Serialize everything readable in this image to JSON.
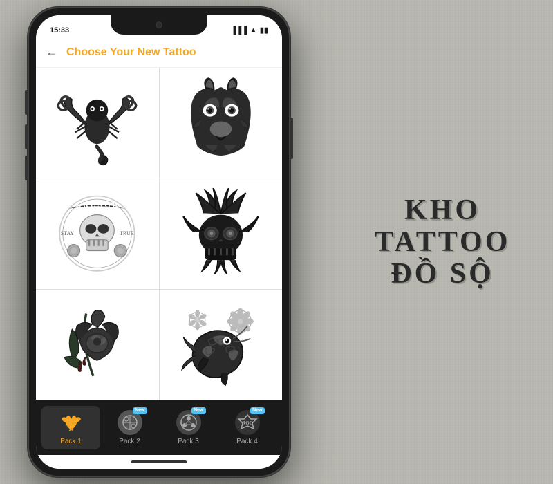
{
  "app": {
    "status_time": "15:33",
    "header_title": "Choose Your New Tattoo"
  },
  "background": {
    "brand_line1": "KHO TATTOO",
    "brand_line2": "ĐỒ SỘ"
  },
  "tabs": [
    {
      "id": "pack1",
      "label": "Pack 1",
      "active": true,
      "new_badge": false
    },
    {
      "id": "pack2",
      "label": "Pack 2",
      "active": false,
      "new_badge": true
    },
    {
      "id": "pack3",
      "label": "Pack 3",
      "active": false,
      "new_badge": true
    },
    {
      "id": "pack4",
      "label": "Pack 4",
      "active": false,
      "new_badge": true
    }
  ],
  "tattoos": [
    {
      "id": "scorpion",
      "alt": "Scorpion tattoo"
    },
    {
      "id": "wolf",
      "alt": "Wolf head tattoo"
    },
    {
      "id": "grunge-skull",
      "alt": "Grunge skull tattoo"
    },
    {
      "id": "dark-skull",
      "alt": "Dark skull with tentacles"
    },
    {
      "id": "rose",
      "alt": "Dark rose tattoo"
    },
    {
      "id": "koi",
      "alt": "Koi fish tattoo"
    }
  ]
}
